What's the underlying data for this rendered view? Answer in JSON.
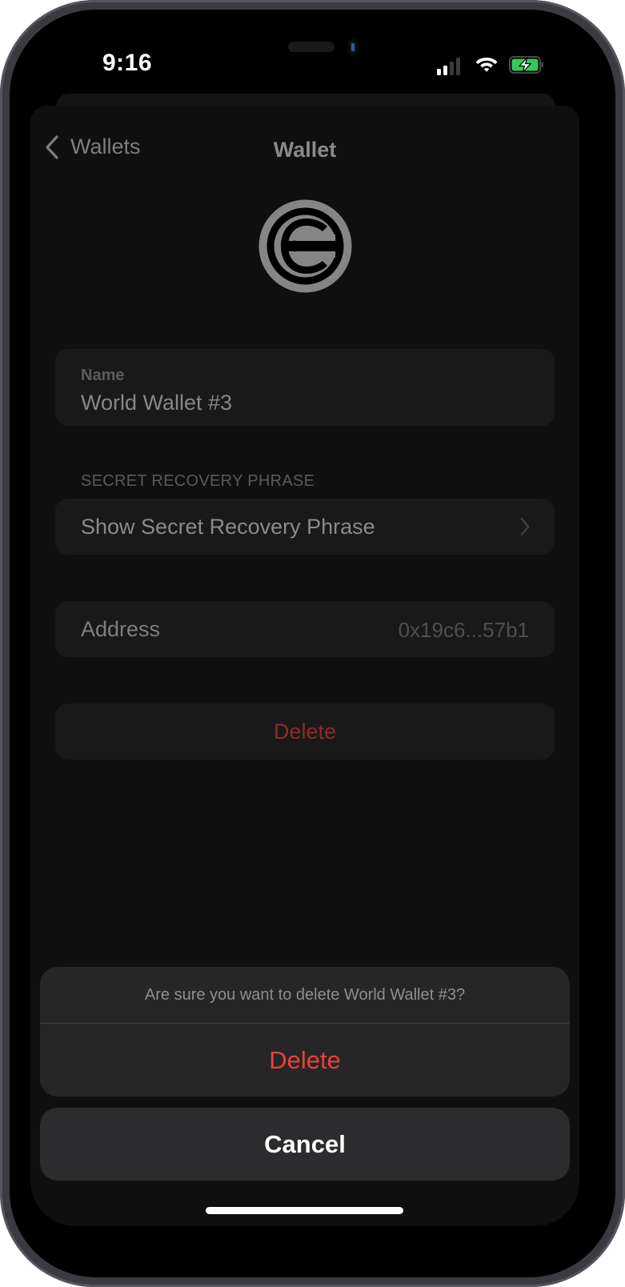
{
  "status_bar": {
    "time": "9:16",
    "signal_bars_active": 2,
    "signal_bars_total": 4,
    "wifi_icon": "wifi-icon",
    "battery_icon": "battery-charging-icon",
    "battery_color": "#34c759"
  },
  "nav": {
    "back_label": "Wallets",
    "back_icon": "chevron-left-icon",
    "title": "Wallet"
  },
  "wallet": {
    "logo_icon": "worldcoin-logo-icon",
    "name_label": "Name",
    "name_value": "World Wallet #3",
    "recovery_section_label": "SECRET RECOVERY PHRASE",
    "show_phrase_label": "Show Secret Recovery Phrase",
    "address_label": "Address",
    "address_value": "0x19c6...57b1",
    "delete_label": "Delete"
  },
  "action_sheet": {
    "message": "Are sure you want to delete World Wallet #3?",
    "delete_label": "Delete",
    "cancel_label": "Cancel",
    "destructive_color": "#eb4133"
  }
}
